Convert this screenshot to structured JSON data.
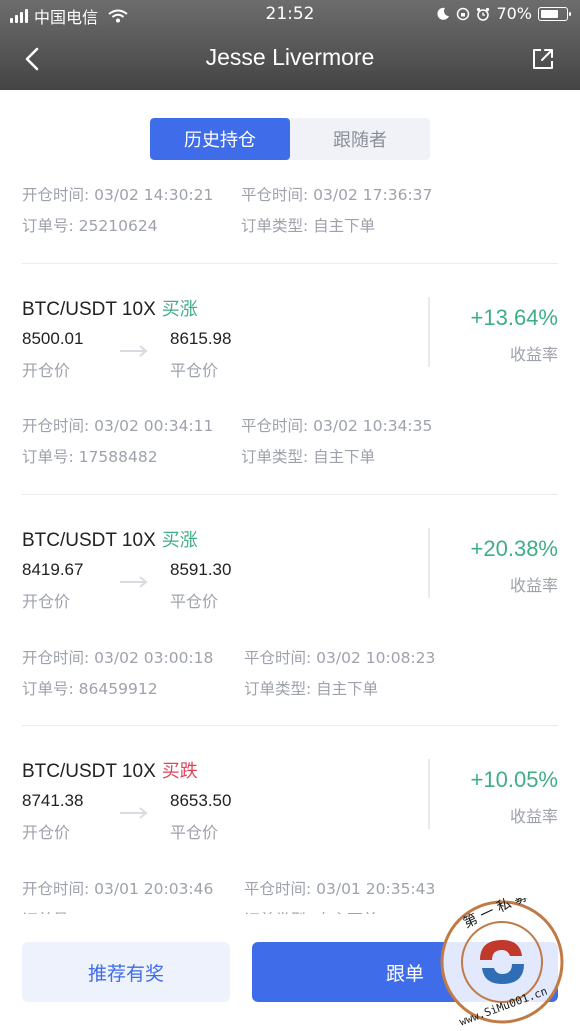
{
  "status_bar": {
    "carrier": "中国电信",
    "time": "21:52",
    "battery": "70%",
    "battery_level": 0.7
  },
  "nav": {
    "title": "Jesse Livermore",
    "back_icon": "chevron-left-icon",
    "share_icon": "share-icon"
  },
  "tabs": [
    {
      "label": "历史持仓",
      "active": true
    },
    {
      "label": "跟随者",
      "active": false
    }
  ],
  "labels": {
    "open_time": "开仓时间:",
    "close_time": "平仓时间:",
    "order_no": "订单号:",
    "order_type": "订单类型:",
    "open_price": "开仓价",
    "close_price": "平仓价",
    "yield": "收益率"
  },
  "top_meta": {
    "open_time": "03/02 14:30:21",
    "close_time": "03/02 17:36:37",
    "order_no": "25210624",
    "order_type": "自主下单"
  },
  "positions": [
    {
      "pair": "BTC/USDT 10X",
      "direction": "买涨",
      "direction_color": "#3fae85",
      "open_price": "8500.01",
      "close_price": "8615.98",
      "yield": "+13.64%",
      "open_time": "03/02 00:34:11",
      "close_time": "03/02 10:34:35",
      "order_no": "17588482",
      "order_type": "自主下单"
    },
    {
      "pair": "BTC/USDT 10X",
      "direction": "买涨",
      "direction_color": "#3fae85",
      "open_price": "8419.67",
      "close_price": "8591.30",
      "yield": "+20.38%",
      "open_time": "03/02 03:00:18",
      "close_time": "03/02 10:08:23",
      "order_no": "86459912",
      "order_type": "自主下单"
    },
    {
      "pair": "BTC/USDT 10X",
      "direction": "买跌",
      "direction_color": "#e0445a",
      "open_price": "8741.38",
      "close_price": "8653.50",
      "yield": "+10.05%",
      "open_time": "03/01 20:03:46",
      "close_time": "03/01 20:35:43",
      "order_no": "",
      "order_type": "自主下单"
    }
  ],
  "bottom": {
    "refer_label": "推荐有奖",
    "follow_label": "跟单"
  },
  "colors": {
    "accent": "#3f6ce8",
    "gain": "#3fae85",
    "loss": "#e0445a"
  },
  "watermark": {
    "text": "第一私募 www.SiMu001.cn"
  }
}
